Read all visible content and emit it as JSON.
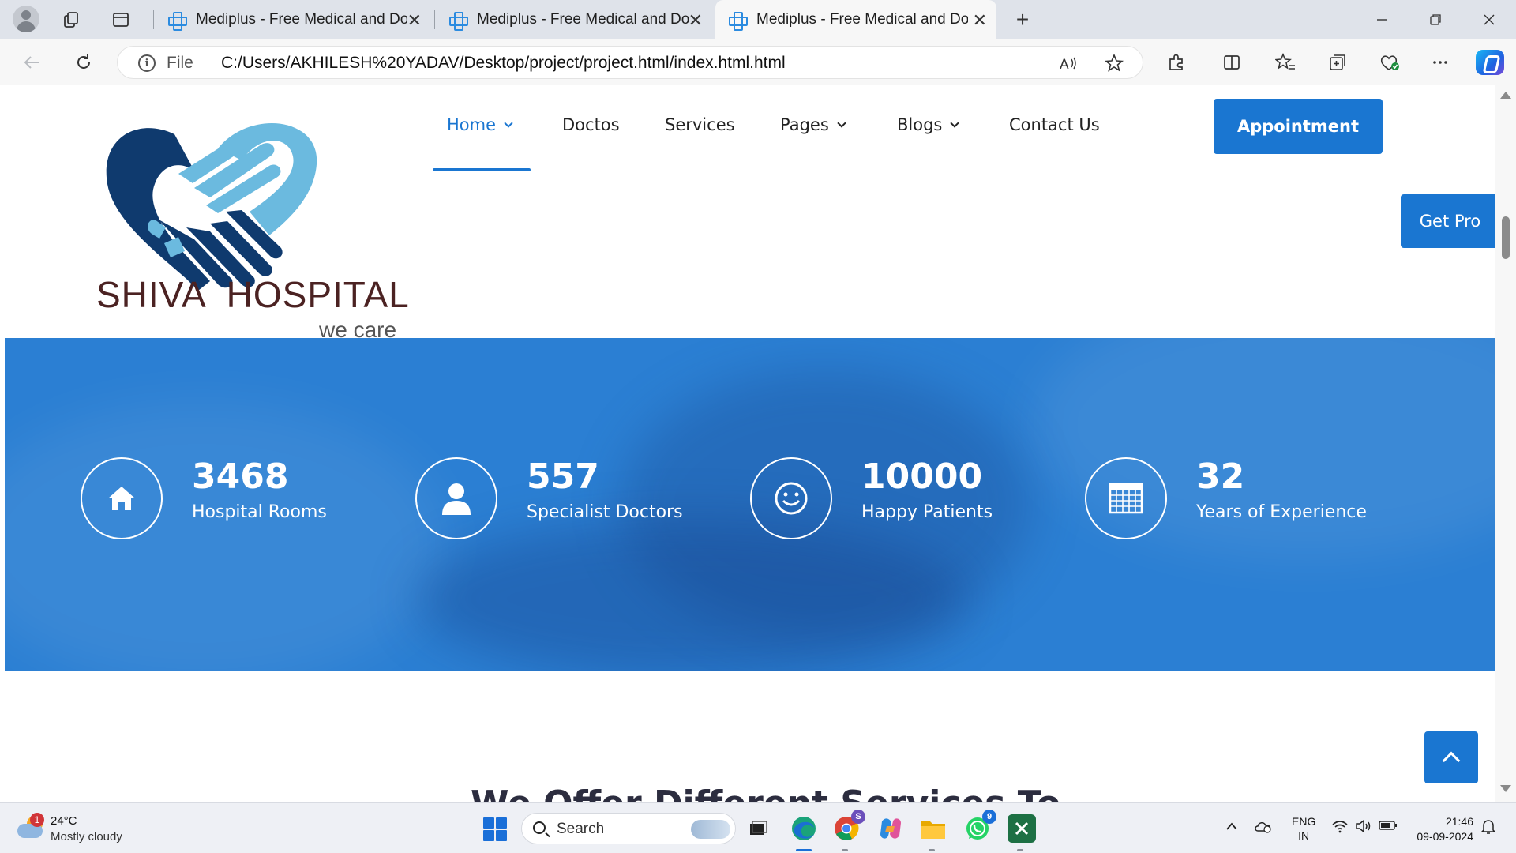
{
  "browser": {
    "tabs": [
      {
        "title": "Mediplus - Free Medical and Doct"
      },
      {
        "title": "Mediplus - Free Medical and Doct"
      },
      {
        "title": "Mediplus - Free Medical and Doct"
      }
    ],
    "active_tab_index": 2,
    "address": {
      "scheme_label": "File",
      "url": "C:/Users/AKHILESH%20YADAV/Desktop/project/project.html/index.html.html"
    }
  },
  "site": {
    "logo": {
      "name": "SHIVA  HOSPITAL",
      "tagline": "we care",
      "colors": {
        "dark": "#0f3a6e",
        "light": "#6bbadf",
        "text": "#4b2222"
      }
    },
    "nav": [
      {
        "label": "Home",
        "has_dropdown": true,
        "active": true
      },
      {
        "label": "Doctos",
        "has_dropdown": false
      },
      {
        "label": "Services",
        "has_dropdown": false
      },
      {
        "label": "Pages",
        "has_dropdown": true
      },
      {
        "label": "Blogs",
        "has_dropdown": true
      },
      {
        "label": "Contact Us",
        "has_dropdown": false
      }
    ],
    "appointment_label": "Appointment",
    "get_pro_label": "Get Pro",
    "accent_color": "#1a76d1",
    "stats": [
      {
        "icon": "home-icon",
        "number": "3468",
        "label": "Hospital Rooms"
      },
      {
        "icon": "user-icon",
        "number": "557",
        "label": "Specialist Doctors"
      },
      {
        "icon": "smile-icon",
        "number": "10000",
        "label": "Happy Patients"
      },
      {
        "icon": "calendar-grid-icon",
        "number": "32",
        "label": "Years of Experience"
      }
    ],
    "next_section_heading": "We Offer Different Services To"
  },
  "taskbar": {
    "weather": {
      "temp": "24°C",
      "desc": "Mostly cloudy",
      "badge": "1"
    },
    "search_placeholder": "Search",
    "apps": [
      {
        "name": "file-explorer-dark-icon"
      },
      {
        "name": "edge-icon"
      },
      {
        "name": "chrome-icon",
        "badge": "S"
      },
      {
        "name": "copilot-app-icon"
      },
      {
        "name": "folder-icon"
      },
      {
        "name": "whatsapp-icon",
        "badge": "9"
      },
      {
        "name": "excel-icon"
      }
    ],
    "language": {
      "line1": "ENG",
      "line2": "IN"
    },
    "clock": {
      "time": "21:46",
      "date": "09-09-2024"
    }
  }
}
